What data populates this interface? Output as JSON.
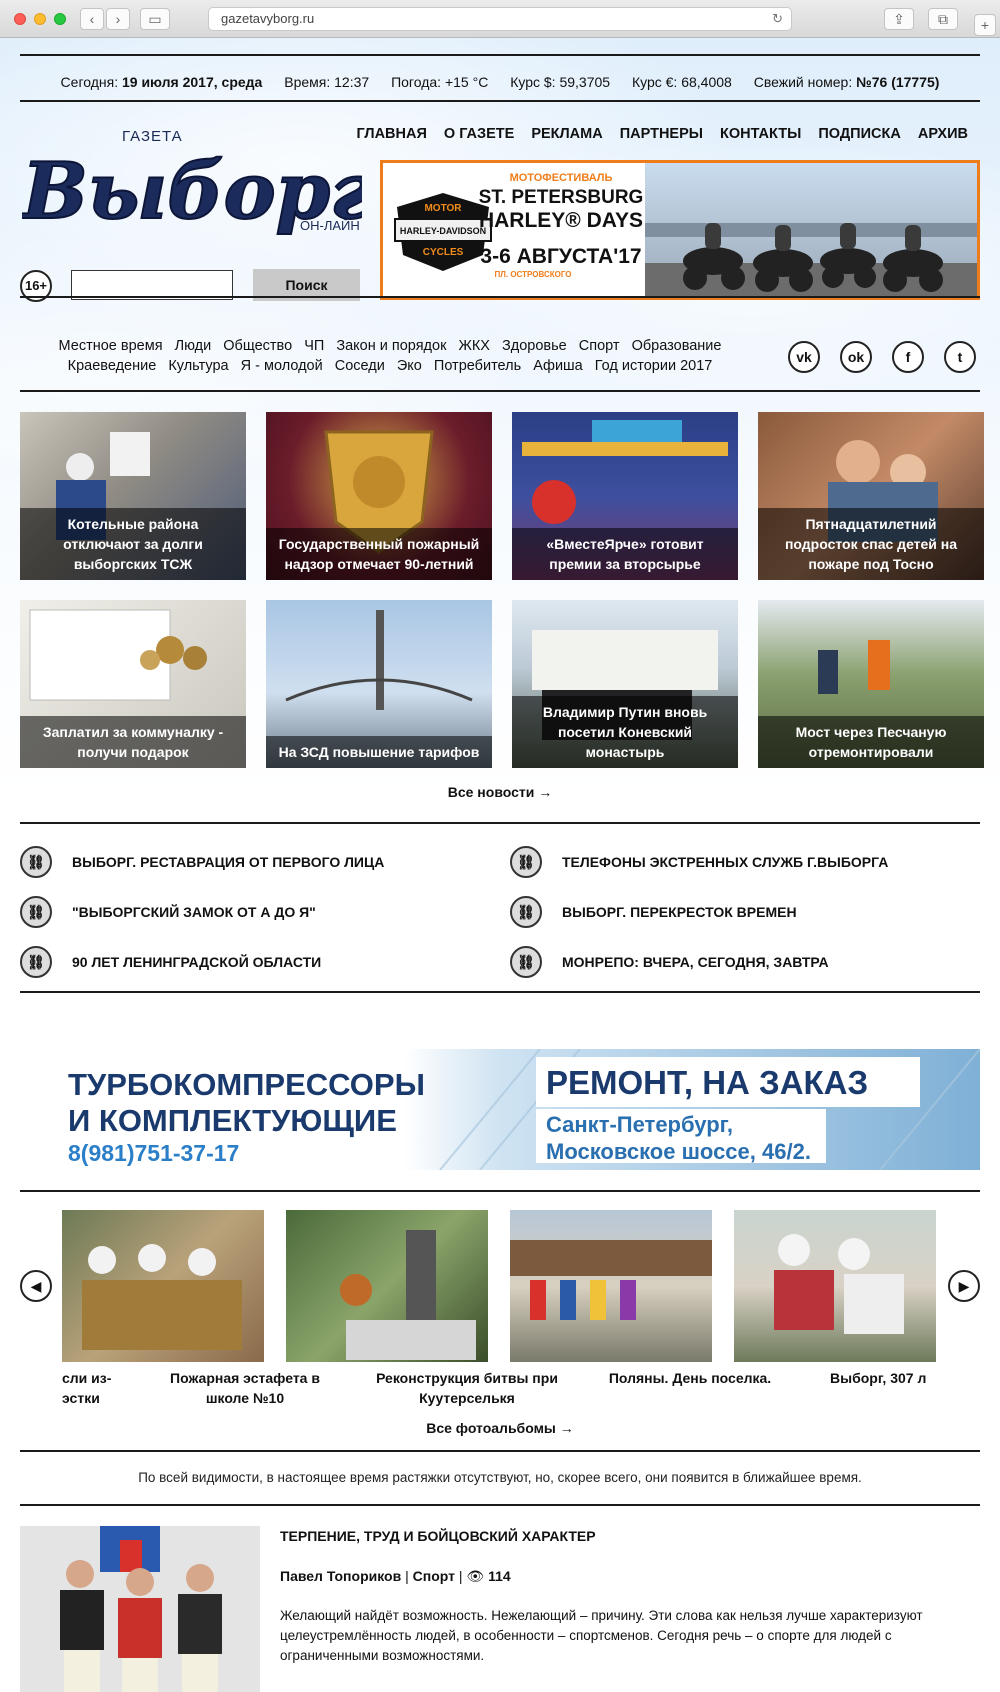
{
  "browser": {
    "url": "gazetavyborg.ru"
  },
  "info": {
    "today_label": "Сегодня:",
    "today_value": "19 июля 2017, среда",
    "time_label": "Время:",
    "time_value": "12:37",
    "weather_label": "Погода:",
    "weather_value": "+15 °C",
    "usd_label": "Курс $:",
    "usd_value": "59,3705",
    "eur_label": "Курс €:",
    "eur_value": "68,4008",
    "issue_label": "Свежий номер:",
    "issue_value": "№76 (17775)"
  },
  "logo": {
    "top": "ГАЗЕТА",
    "main": "Выборг",
    "bottom": "ОН-ЛАЙН"
  },
  "main_nav": [
    "ГЛАВНАЯ",
    "О ГАЗЕТЕ",
    "РЕКЛАМА",
    "ПАРТНЕРЫ",
    "КОНТАКТЫ",
    "ПОДПИСКА",
    "АРХИВ"
  ],
  "top_banner": {
    "line1": "МОТОФЕСТИВАЛЬ",
    "line2": "ST. PETERSBURG",
    "line3": "HARLEY® DAYS",
    "dates": "3-6 АВГУСТА'17",
    "place": "ПЛ. ОСТРОВСКОГО",
    "brand1": "MOTOR",
    "brand2": "HARLEY-DAVIDSON",
    "brand3": "CYCLES"
  },
  "age_badge": "16+",
  "search": {
    "value": "",
    "button": "Поиск"
  },
  "rubrics_row1": [
    "Местное время",
    "Люди",
    "Общество",
    "ЧП",
    "Закон и порядок",
    "ЖКХ",
    "Здоровье",
    "Спорт",
    "Образование"
  ],
  "rubrics_row2": [
    "Краеведение",
    "Культура",
    "Я - молодой",
    "Соседи",
    "Эко",
    "Потребитель",
    "Афиша",
    "Год истории 2017"
  ],
  "social": [
    {
      "icon": "vk-icon",
      "glyph": "vk"
    },
    {
      "icon": "odnoklassniki-icon",
      "glyph": "ok"
    },
    {
      "icon": "facebook-icon",
      "glyph": "f"
    },
    {
      "icon": "twitter-icon",
      "glyph": "t"
    }
  ],
  "news": [
    {
      "title": "Котельные района отключают за долги выборгских ТСЖ"
    },
    {
      "title": "Государственный пожарный надзор отмечает 90-летний"
    },
    {
      "title": "«ВместеЯрче» готовит премии за вторсырье"
    },
    {
      "title": "Пятнадцатилетний подросток спас детей на пожаре под Тосно"
    },
    {
      "title": "Заплатил за коммуналку - получи подарок"
    },
    {
      "title": "На ЗСД повышение тарифов"
    },
    {
      "title": "Владимир Путин вновь посетил Коневский монастырь"
    },
    {
      "title": "Мост через Песчаную отремонтировали"
    }
  ],
  "all_news": "Все новости →",
  "special_links": [
    "ВЫБОРГ. РЕСТАВРАЦИЯ ОТ ПЕРВОГО ЛИЦА",
    "ТЕЛЕФОНЫ ЭКСТРЕННЫХ СЛУЖБ Г.ВЫБОРГА",
    "\"ВЫБОРГСКИЙ ЗАМОК ОТ А ДО Я\"",
    "ВЫБОРГ. ПЕРЕКРЕСТОК ВРЕМЕН",
    "90 ЛЕТ ЛЕНИНГРАДСКОЙ ОБЛАСТИ",
    "МОНРЕПО: ВЧЕРА, СЕГОДНЯ, ЗАВТРА"
  ],
  "ad_banner": {
    "left1": "ТУРБОКОМПРЕССОРЫ",
    "left2": "И КОМПЛЕКТУЮЩИЕ",
    "phone": "8(981)751-37-17",
    "right1": "РЕМОНТ, НА ЗАКАЗ",
    "right2": "Санкт-Петербург,",
    "right3": "Московское шоссе, 46/2."
  },
  "albums": [
    {
      "title": "сли из- эстки"
    },
    {
      "title": "Пожарная эстафета в школе №10"
    },
    {
      "title": "Реконструкция битвы при Куутерселькя"
    },
    {
      "title": "Поляны. День поселка."
    },
    {
      "title": "Выборг, 307 л"
    }
  ],
  "all_albums": "Все фотоальбомы →",
  "notice": "По всей видимости, в настоящее время растяжки отсутствуют, но, скорее всего, они появится в ближайшее время.",
  "article": {
    "title": "ТЕРПЕНИЕ, ТРУД И БОЙЦОВСКИЙ ХАРАКТЕР",
    "author": "Павел Топориков",
    "category": "Спорт",
    "views": "114",
    "text": "Желающий найдёт возможность. Нежелающий – причину. Эти слова как нельзя лучше характеризуют целеустремлённость людей, в особенности – спортсменов. Сегодня речь – о спорте для людей с ограниченными возможностями."
  }
}
